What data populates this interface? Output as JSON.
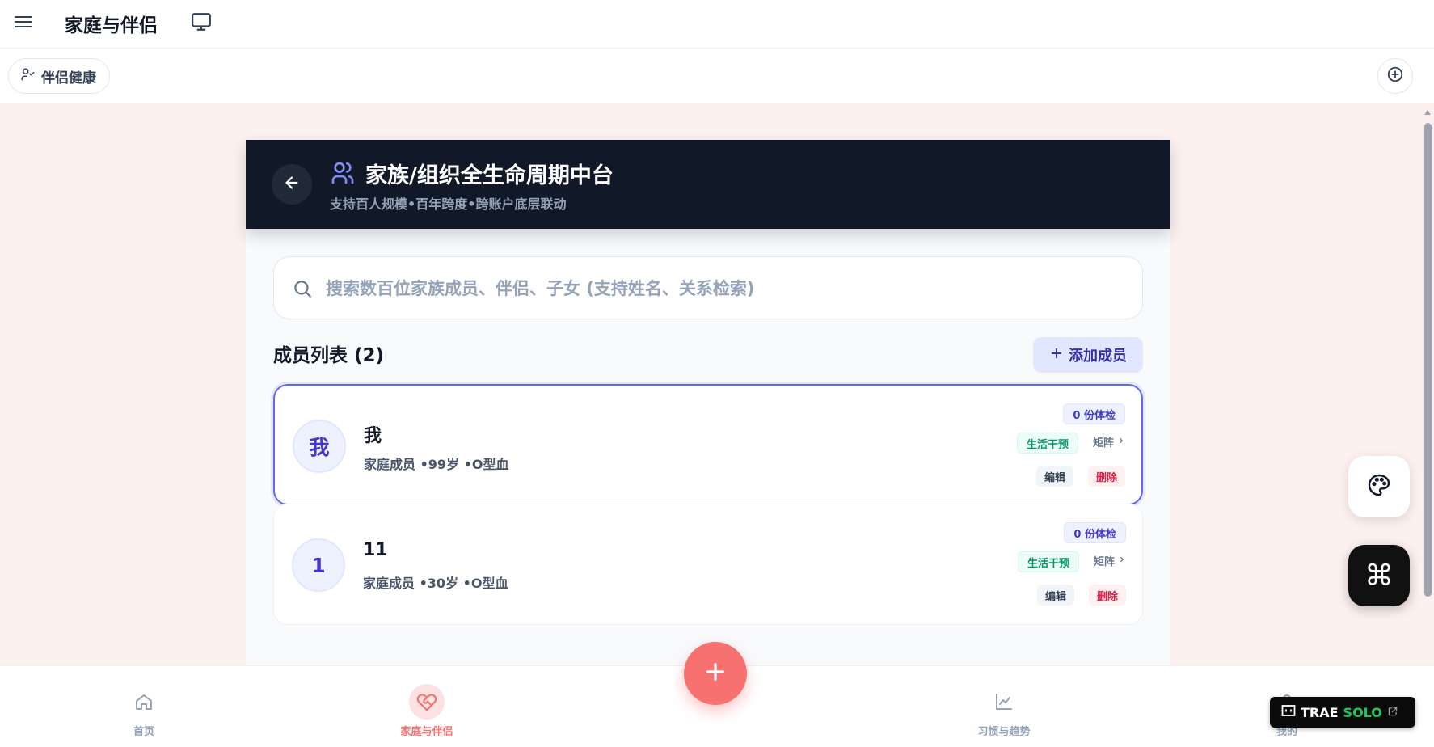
{
  "header": {
    "app_title": "家庭与伴侣",
    "menu_icon": "menu-icon",
    "monitor_icon": "monitor-icon"
  },
  "tabs": {
    "active_tab_label": "伴侣健康",
    "active_tab_icon": "user-check-icon",
    "add_icon": "plus-circle-icon"
  },
  "hero": {
    "title": "家族/组织全生命周期中台",
    "subtitle": "支持百人规模•百年跨度•跨账户底层联动",
    "back_icon": "arrow-left-icon",
    "users_icon": "users-icon"
  },
  "search": {
    "placeholder": "搜索数百位家族成员、伴侣、子女 (支持姓名、关系检索)",
    "value": ""
  },
  "members_section": {
    "title": "成员列表 (2)",
    "add_button_label": "添加成员"
  },
  "members": [
    {
      "avatar": "我",
      "name": "我",
      "meta": "家庭成员 •99岁 •O型血",
      "exam_badge": "0 份体检",
      "life_badge": "生活干预",
      "matrix_label": "矩阵",
      "edit_label": "编辑",
      "delete_label": "删除",
      "selected": true
    },
    {
      "avatar": "1",
      "name": "11",
      "meta": "家庭成员 •30岁 •O型血",
      "exam_badge": "0 份体检",
      "life_badge": "生活干预",
      "matrix_label": "矩阵",
      "edit_label": "编辑",
      "delete_label": "删除",
      "selected": false
    }
  ],
  "bottom_nav": {
    "items": [
      {
        "label": "首页",
        "icon": "home-icon",
        "active": false
      },
      {
        "label": "家庭与伴侣",
        "icon": "heart-handshake-icon",
        "active": true
      },
      {
        "label": "习惯与趋势",
        "icon": "chart-line-icon",
        "active": false
      },
      {
        "label": "我的",
        "icon": "user-icon",
        "active": false
      }
    ],
    "center_button_icon": "plus-icon"
  },
  "floating": {
    "palette_icon": "palette-icon",
    "command_symbol": "⌘"
  },
  "trae_badge": {
    "brand": "TRAE",
    "product": "SOLO"
  },
  "colors": {
    "accent": "#6366f1",
    "brand_red": "#f87171",
    "hero_bg": "#111827",
    "page_tint": "#fdf1ef"
  }
}
